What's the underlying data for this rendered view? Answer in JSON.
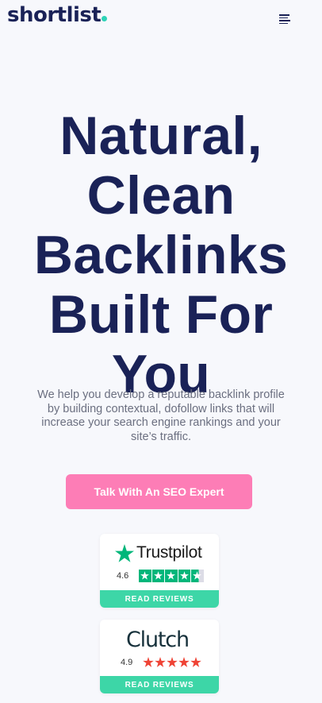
{
  "header": {
    "logo_text": "shortlist",
    "logo_dot_color": "#2ed3b7",
    "menu_icon": "hamburger-menu-icon"
  },
  "hero": {
    "title_lines": [
      "Natural,",
      "Clean",
      "Backlinks",
      "Built For You"
    ],
    "subtitle": "We help you develop a reputable backlink profile by building contextual, dofollow links that will increase your search engine rankings and your site’s traffic.",
    "cta_label": "Talk With An SEO Expert",
    "cta_color": "#fd7db6"
  },
  "reviews": [
    {
      "brand": "Trustpilot",
      "rating": "4.6",
      "stars_filled": 4.6,
      "stars_total": 5,
      "button_label": "READ REVIEWS",
      "brand_color": "#00b67a"
    },
    {
      "brand": "Clutch",
      "rating": "4.9",
      "stars_filled": 5,
      "stars_total": 5,
      "button_label": "READ REVIEWS",
      "brand_color": "#ef4335"
    }
  ],
  "colors": {
    "background": "#f7f8fc",
    "navy": "#1a2257",
    "review_button": "#3dd6a7"
  }
}
